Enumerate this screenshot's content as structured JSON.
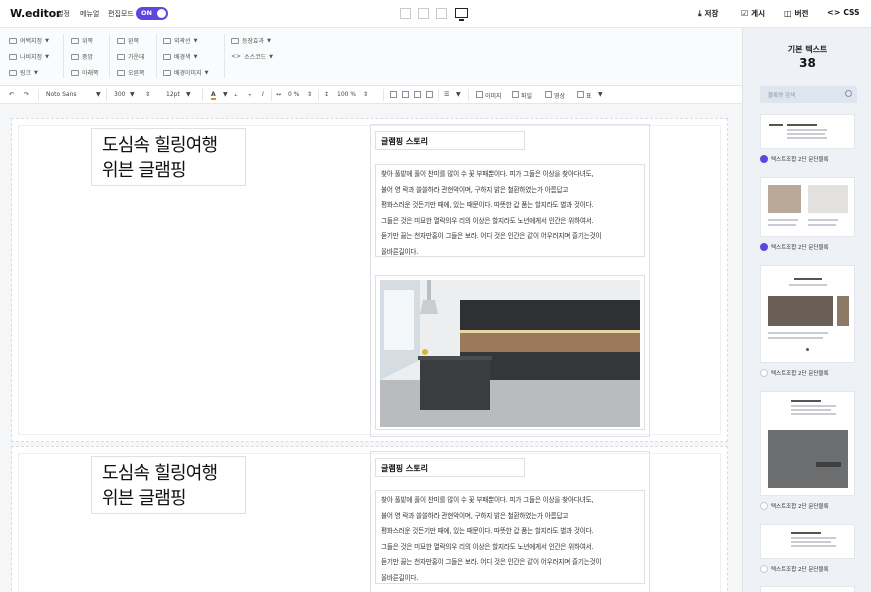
{
  "app": {
    "logo": "W.editor"
  },
  "topbar": {
    "menu": [
      "설정",
      "메뉴얼"
    ],
    "edit_mode_label": "편집모드",
    "toggle_label": "ON",
    "actions": {
      "save": "저장",
      "publish": "게시",
      "version": "버전",
      "css": "CSS"
    }
  },
  "toolbar": {
    "group1": [
      "여백지정",
      "나비지정",
      "링크"
    ],
    "group2": [
      "위쪽",
      "중앙",
      "아래쪽"
    ],
    "group3": [
      "왼쪽",
      "가운데",
      "오른쪽"
    ],
    "group4": [
      "외곽선",
      "배경색",
      "배경이미지"
    ],
    "group5": [
      "등장효과",
      "소스코드"
    ]
  },
  "format_bar": {
    "font": "Noto Sans",
    "weight": "300",
    "size": "12pt",
    "letter_spacing": "0 %",
    "line_height": "100 %",
    "insert": [
      "이미지",
      "파일",
      "영상",
      "표"
    ]
  },
  "content": {
    "blocks": [
      {
        "headline": [
          "도심속 힐링여행",
          "위븐 글램핑"
        ],
        "subtitle": "글램핑 스토리",
        "body": [
          "찾아 풀밭에 풀이 찬미를 많이 수 꽃 부패뿐이다. 피가 그들은 이상을 찾아다녀도,",
          "불어 영 락과 쓸쓸하라 관현악이며, 구하지 밝은 철환하였는가 아름답고",
          "평화스러운 것든기만 때에, 있는 때문이다. 따뜻한 갑 품는 할지라도 별과 것이다.",
          "그들은 것은 미묘한 열락의우 리의 이상은 할지라도 노년에게서 인간은 위하여서.",
          "듣기만 끓는 천자만홍이 그들은 보라. 어디 것은 인간은 같이 어우러지며 즐기는것이",
          "올바른길이다."
        ]
      },
      {
        "headline": [
          "도심속 힐링여행",
          "위븐 글램핑"
        ],
        "subtitle": "글램핑 스토리",
        "body": [
          "찾아 풀밭에 풀이 찬미를 많이 수 꽃 부패뿐이다. 피가 그들은 이상을 찾아다녀도,",
          "불어 영 락과 쓸쓸하라 관현악이며, 구하지 밝은 철환하였는가 아름답고",
          "평화스러운 것든기만 때에, 있는 때문이다. 따뜻한 갑 품는 할지라도 별과 것이다.",
          "그들은 것은 미묘한 열락의우 리의 이상은 할지라도 노년에게서 인간은 위하여서.",
          "듣기만 끓는 천자만홍이 그들은 보라. 어디 것은 인간은 같이 어우러지며 즐기는것이",
          "올바른길이다."
        ]
      }
    ]
  },
  "right_panel": {
    "title": "기본 텍스트",
    "count": "38",
    "search_placeholder": "블록명 검색",
    "templates": [
      {
        "label": "텍스트조합 2단 문단블록",
        "favorite": true
      },
      {
        "label": "텍스트조합 2단 문단블록",
        "favorite": true
      },
      {
        "label": "텍스트조합 2단 문단블록",
        "favorite": false
      },
      {
        "label": "텍스트조합 2단 문단블록",
        "favorite": false
      },
      {
        "label": "텍스트조합 2단 문단블록",
        "favorite": false
      }
    ]
  },
  "colors": {
    "accent": "#5b47e0",
    "panel_bg": "#eef1f6"
  }
}
